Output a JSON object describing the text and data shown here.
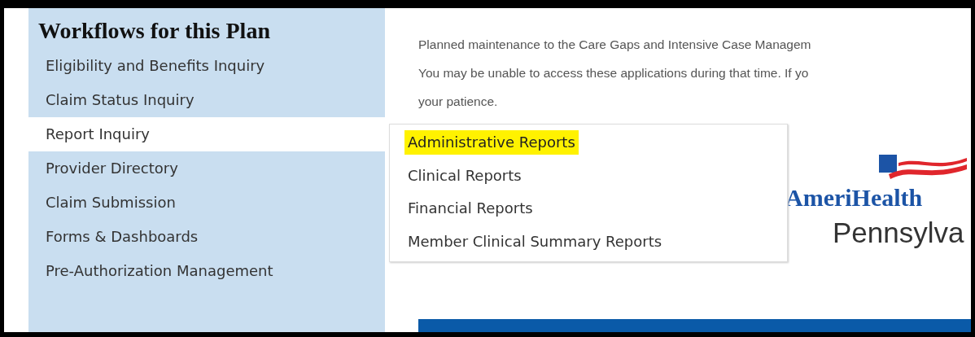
{
  "sidebar": {
    "title": "Workflows for this Plan",
    "items": [
      {
        "label": "Eligibility and Benefits Inquiry",
        "selected": false
      },
      {
        "label": "Claim Status Inquiry",
        "selected": false
      },
      {
        "label": "Report Inquiry",
        "selected": true
      },
      {
        "label": "Provider Directory",
        "selected": false
      },
      {
        "label": "Claim Submission",
        "selected": false
      },
      {
        "label": "Forms & Dashboards",
        "selected": false
      },
      {
        "label": "Pre-Authorization Management",
        "selected": false
      }
    ]
  },
  "notice": {
    "lines": [
      "Planned maintenance to the Care Gaps and Intensive Case Managem",
      "You may be unable to access these applications during that time. If yo",
      "your patience."
    ]
  },
  "submenu": {
    "items": [
      {
        "label": "Administrative Reports",
        "selected": true
      },
      {
        "label": "Clinical Reports",
        "selected": false
      },
      {
        "label": "Financial Reports",
        "selected": false
      },
      {
        "label": "Member Clinical Summary Reports",
        "selected": false
      }
    ]
  },
  "logo": {
    "name": "AmeriHealth",
    "region": "Pennsylva"
  }
}
